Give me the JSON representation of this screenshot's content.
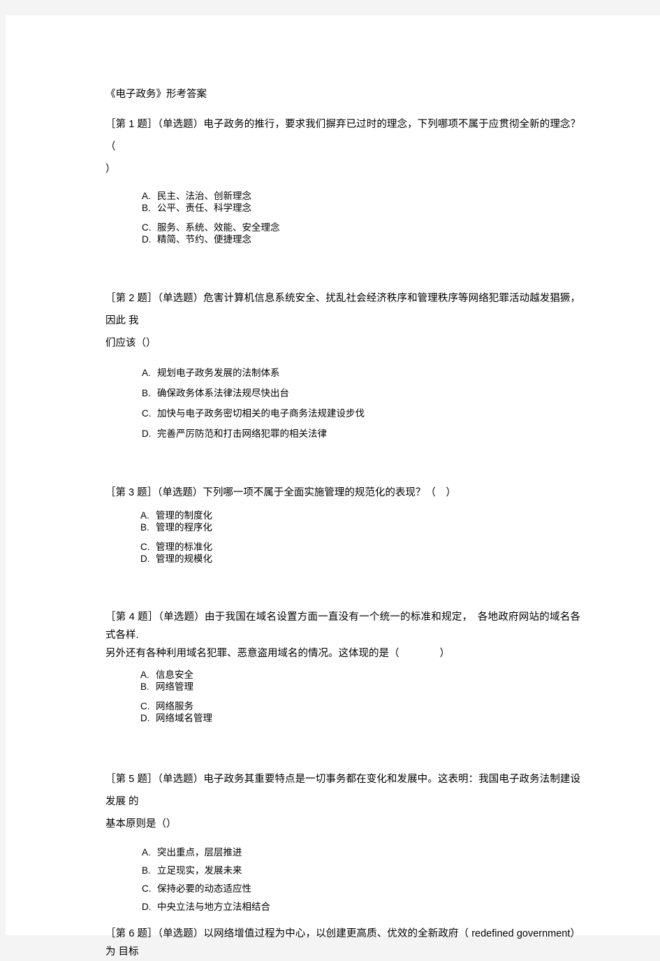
{
  "document": {
    "title": "《电子政务》形考答案",
    "background_color": "#f4f4f4",
    "page_color": "#ffffff",
    "text_color": "#000000"
  },
  "questions": [
    {
      "stem_line1": "［第 1 题］（单选题）电子政务的推行，要求我们摒弃已过时的理念，下列哪项不属于应贯彻全新的理念？（",
      "stem_line2": "）",
      "options": [
        {
          "label": "A.",
          "text": "民主、法治、创新理念"
        },
        {
          "label": "B.",
          "text": "公平、责任、科学理念"
        },
        {
          "label": "C.",
          "text": "服务、系统、效能、安全理念"
        },
        {
          "label": "D.",
          "text": "精简、节约、便捷理念"
        }
      ]
    },
    {
      "stem_line1": "［第 2 题］（单选题）危害计算机信息系统安全、扰乱社会经济秩序和管理秩序等网络犯罪活动越发猖獗，因此 我",
      "stem_line2": "们应该（）",
      "options": [
        {
          "label": "A.",
          "text": "规划电子政务发展的法制体系"
        },
        {
          "label": "B.",
          "text": "确保政务体系法律法规尽快出台"
        },
        {
          "label": "C.",
          "text": "加快与电子政务密切相关的电子商务法规建设步伐"
        },
        {
          "label": "D.",
          "text": "完善严厉防范和打击网络犯罪的相关法律"
        }
      ]
    },
    {
      "stem_line1": "［第 3 题］（单选题）下列哪一项不属于全面实施管理的规范化的表现？（　）",
      "stem_line2": "",
      "options": [
        {
          "label": "A.",
          "text": "管理的制度化"
        },
        {
          "label": "B.",
          "text": "管理的程序化"
        },
        {
          "label": "C.",
          "text": "管理的标准化"
        },
        {
          "label": "D.",
          "text": "管理的规模化"
        }
      ]
    },
    {
      "stem_line1": "［第 4 题］（单选题）由于我国在域名设置方面一直没有一个统一的标准和规定，　各地政府网站的域名各式各样.",
      "stem_line2": "另外还有各种利用域名犯罪、恶意盗用域名的情况。这体现的是（　　　　）",
      "options": [
        {
          "label": "A.",
          "text": "信息安全"
        },
        {
          "label": "B.",
          "text": "网络管理"
        },
        {
          "label": "C.",
          "text": "网络服务"
        },
        {
          "label": "D.",
          "text": "网络域名管理"
        }
      ]
    },
    {
      "stem_line1": "［第 5 题］（单选题）电子政务其重要特点是一切事务都在变化和发展中。这表明：我国电子政务法制建设发展 的",
      "stem_line2": "基本原则是（）",
      "options": [
        {
          "label": "A.",
          "text": "突出重点，层层推进"
        },
        {
          "label": "B.",
          "text": "立足现实，发展未来"
        },
        {
          "label": "C.",
          "text": "保持必要的动态适应性"
        },
        {
          "label": "D.",
          "text": "中央立法与地方立法相结合"
        }
      ]
    },
    {
      "stem_line1": "［第 6 题］（单选题）以网络增值过程为中心，以创建更高质、优效的全新政府（ redefined government）为 目标",
      "stem_line2": "",
      "options": []
    }
  ]
}
